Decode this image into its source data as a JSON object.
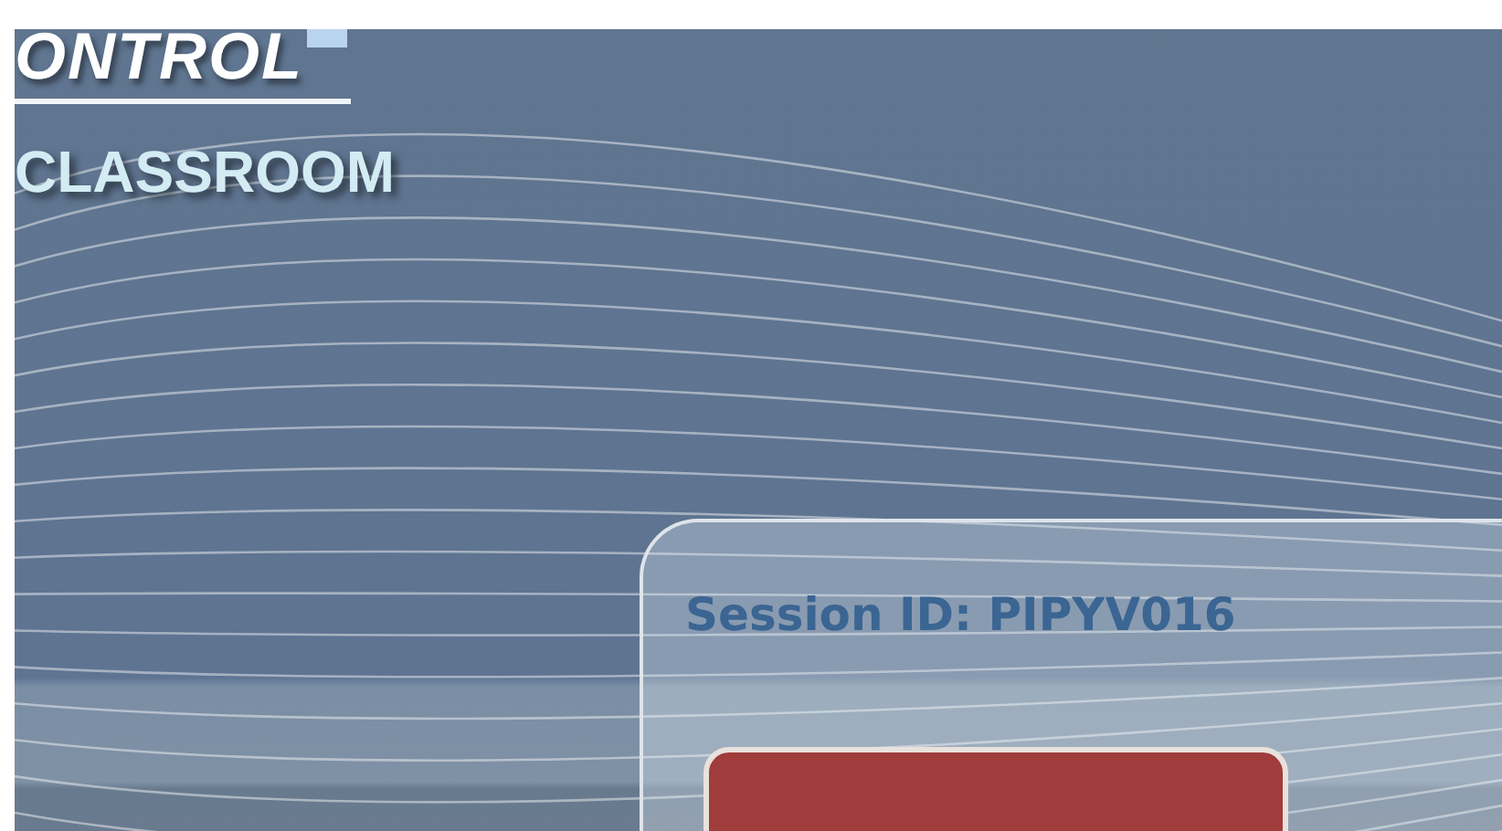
{
  "logo": {
    "title": "ONTROL",
    "subtitle": "CLASSROOM"
  },
  "session_panel": {
    "session_id": "Session ID: PIPYV016"
  }
}
